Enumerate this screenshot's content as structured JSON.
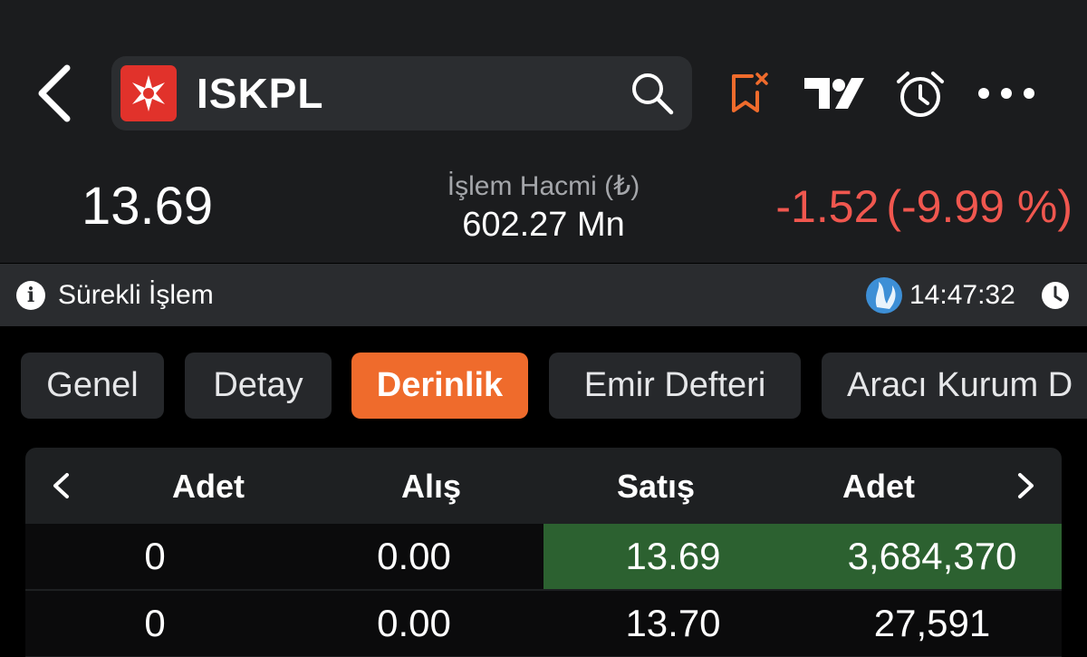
{
  "header": {
    "symbol": "ISKPL",
    "price": "13.69",
    "volume_label": "İşlem Hacmi (₺)",
    "volume_value": "602.27 Mn",
    "change_abs": "-1.52",
    "change_pct": "(-9.99 %)",
    "colors": {
      "negative": "#f0574f",
      "logo_bg": "#e1322b",
      "alert_icon": "#ef6b2c"
    },
    "icons": [
      "back-icon",
      "company-logo",
      "search-icon",
      "watchlist-remove-icon",
      "tradingview-icon",
      "alarm-icon",
      "more-icon"
    ]
  },
  "status": {
    "session": "Sürekli İşlem",
    "time": "14:47:32"
  },
  "tabs": [
    {
      "label": "Genel",
      "active": false
    },
    {
      "label": "Detay",
      "active": false
    },
    {
      "label": "Derinlik",
      "active": true
    },
    {
      "label": "Emir Defteri",
      "active": false
    },
    {
      "label": "Aracı Kurum D",
      "active": false
    }
  ],
  "depth": {
    "headers": [
      "Adet",
      "Alış",
      "Satış",
      "Adet"
    ],
    "rows": [
      {
        "bid_qty": "0",
        "bid": "0.00",
        "ask": "13.69",
        "ask_qty": "3,684,370"
      },
      {
        "bid_qty": "0",
        "bid": "0.00",
        "ask": "13.70",
        "ask_qty": "27,591"
      }
    ],
    "highlight_color": "#2c6130"
  }
}
